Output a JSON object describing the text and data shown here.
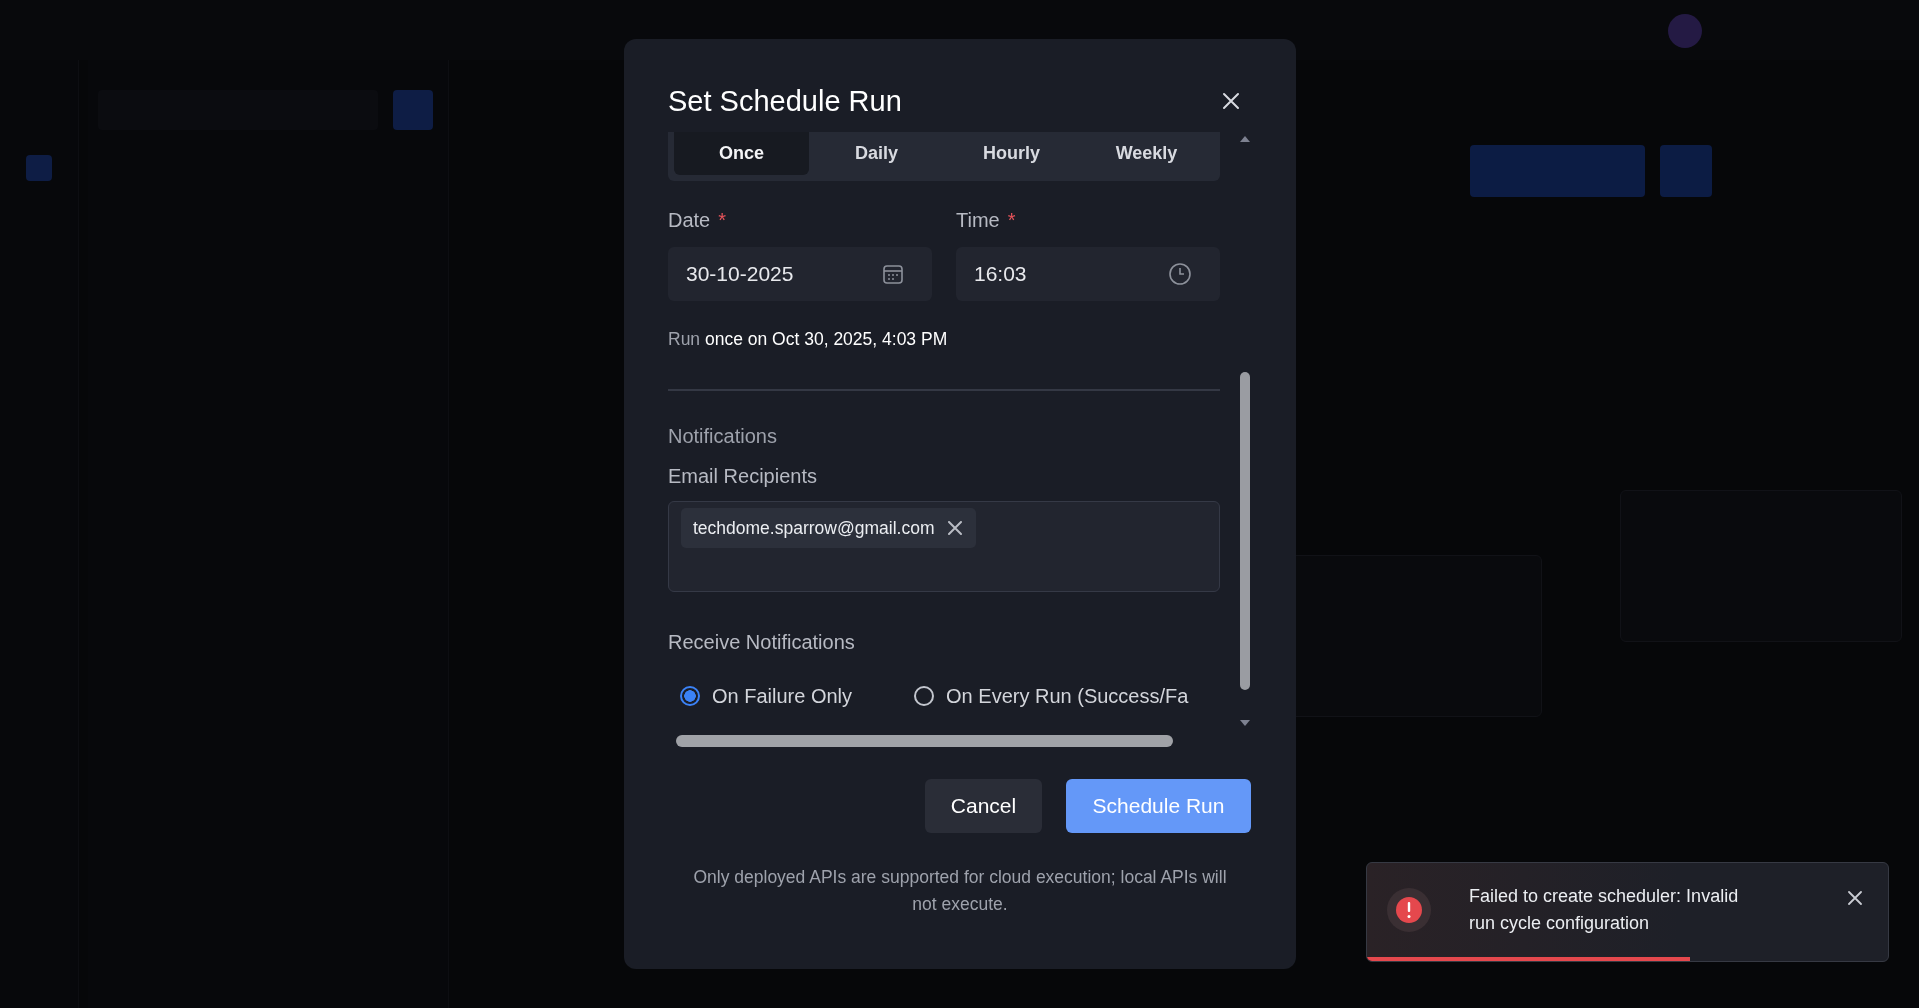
{
  "dialog": {
    "title": "Set Schedule Run",
    "frequency_tabs": [
      {
        "label": "Once",
        "selected": true
      },
      {
        "label": "Daily",
        "selected": false
      },
      {
        "label": "Hourly",
        "selected": false
      },
      {
        "label": "Weekly",
        "selected": false
      }
    ],
    "date": {
      "label": "Date",
      "required_mark": "*",
      "value": "30-10-2025"
    },
    "time": {
      "label": "Time",
      "required_mark": "*",
      "value": "16:03"
    },
    "summary": "Run **once on Oct 30, 2025, 4:03 PM**",
    "notifications_heading": "Notifications",
    "email_label": "Email Recipients",
    "recipients": [
      "techdome.sparrow@gmail.com"
    ],
    "receive_label": "Receive Notifications",
    "notify_options": [
      {
        "label": "On Failure Only",
        "selected": true
      },
      {
        "label": "On Every Run (Success/Fa",
        "selected": false
      }
    ],
    "cancel_button": "Cancel",
    "submit_button": "Schedule Run",
    "note": "Only deployed APIs are supported for cloud execution; local APIs will not execute."
  },
  "toast": {
    "message": "Failed to create scheduler: Invalid run cycle configuration",
    "level": 0.62
  }
}
